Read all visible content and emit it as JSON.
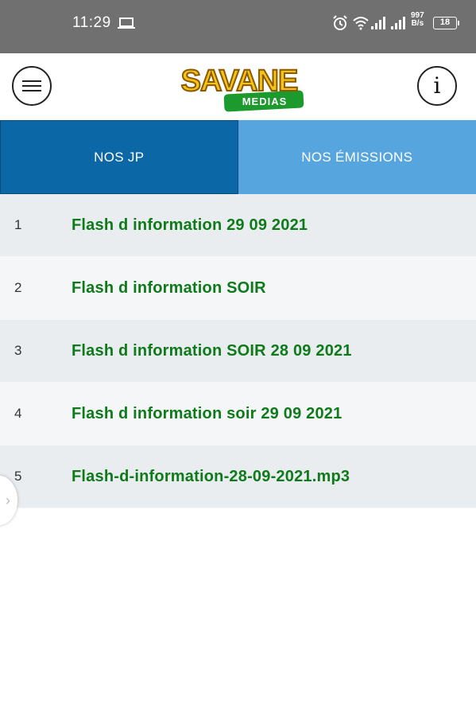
{
  "status_bar": {
    "time": "11:29",
    "net_speed_value": "997",
    "net_speed_unit": "B/s",
    "battery": "18",
    "icons": [
      "laptop-icon",
      "alarm-icon",
      "wifi-icon",
      "signal-icon",
      "signal-icon"
    ]
  },
  "header": {
    "logo_main": "SAVANE",
    "logo_sub": "MEDIAS",
    "menu_icon": "hamburger-menu-icon",
    "info_label": "i"
  },
  "tabs": [
    {
      "label": "NOS JP",
      "active": true
    },
    {
      "label": "NOS ÉMISSIONS",
      "active": false
    }
  ],
  "items": [
    {
      "num": "1",
      "title": "Flash d information 29 09 2021"
    },
    {
      "num": "2",
      "title": "Flash d information SOIR"
    },
    {
      "num": "3",
      "title": "Flash d information SOIR 28 09 2021"
    },
    {
      "num": "4",
      "title": "Flash d information soir 29 09 2021"
    },
    {
      "num": "5",
      "title": "Flash-d-information-28-09-2021.mp3"
    }
  ],
  "side_handle_label": "›",
  "colors": {
    "status_bar": "#707070",
    "tab_active": "#0b67a6",
    "tab_inactive": "#57a5df",
    "item_text": "#0e7a19",
    "logo_yellow": "#f6c21a",
    "logo_green": "#1c9a2e"
  }
}
